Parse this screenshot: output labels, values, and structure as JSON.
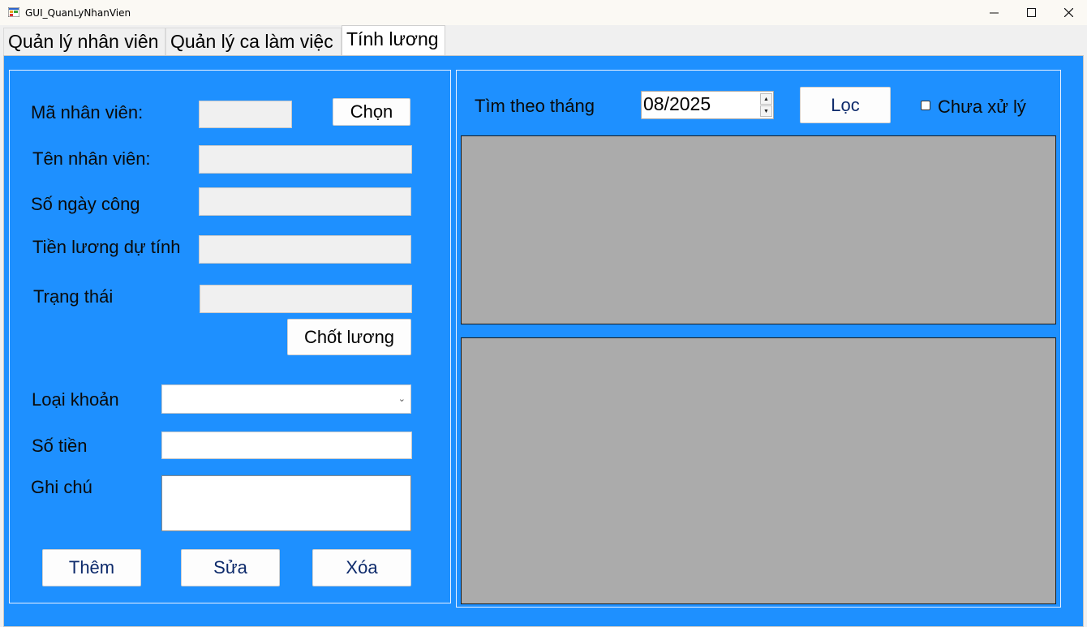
{
  "window": {
    "title": "GUI_QuanLyNhanVien"
  },
  "tabs": [
    {
      "label": "Quản lý nhân viên"
    },
    {
      "label": "Quản lý ca làm việc"
    },
    {
      "label": "Tính lương"
    }
  ],
  "form": {
    "ma_nv_label": "Mã nhân viên:",
    "chon_label": "Chọn",
    "ten_nv_label": "Tên nhân viên:",
    "so_ngay_cong_label": "Số ngày công",
    "tien_luong_label": "Tiền lương dự tính",
    "trang_thai_label": "Trạng thái",
    "chot_luong_label": "Chốt lương",
    "loai_khoan_label": "Loại khoản",
    "so_tien_label": "Số tiền",
    "ghi_chu_label": "Ghi chú",
    "them_label": "Thêm",
    "sua_label": "Sửa",
    "xoa_label": "Xóa"
  },
  "filter": {
    "tim_theo_thang_label": "Tìm theo tháng",
    "month_value": "08/2025",
    "loc_label": "Lọc",
    "chua_xu_ly_label": "Chưa xử lý"
  }
}
